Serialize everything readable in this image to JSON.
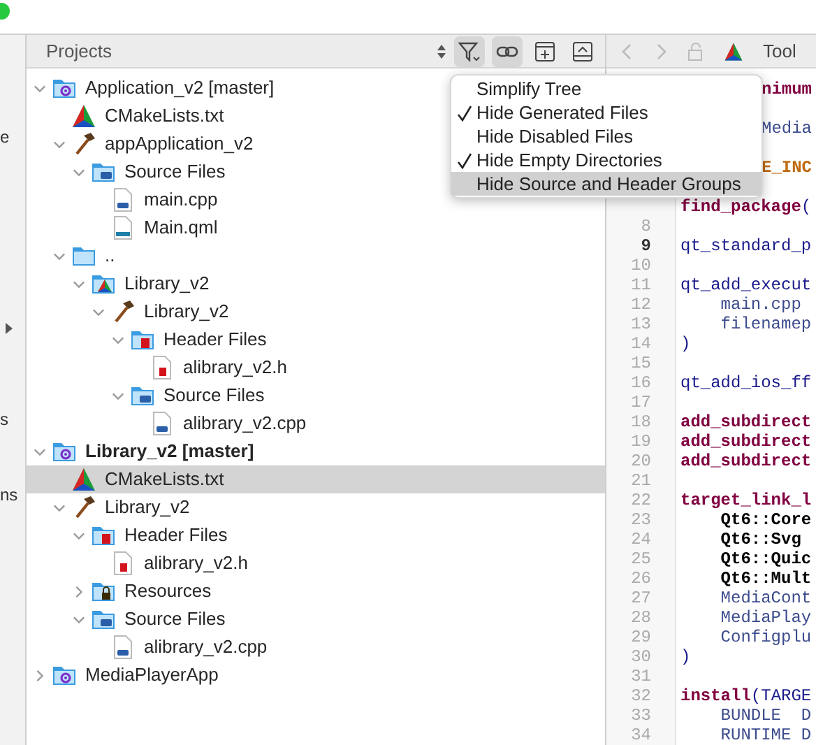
{
  "sidebar_strip": {
    "labels": [
      {
        "text": "e",
        "kind": "text"
      },
      {
        "kind": "arrow"
      },
      {
        "text": "s",
        "kind": "text"
      },
      {
        "text": "ns",
        "kind": "text"
      }
    ]
  },
  "projects_panel": {
    "title": "Projects",
    "toolbar": [
      {
        "kind": "filter",
        "pressed": true
      },
      {
        "kind": "link",
        "pressed": true
      },
      {
        "kind": "split",
        "pressed": false
      },
      {
        "kind": "collapse",
        "pressed": false
      }
    ],
    "filter_menu": [
      {
        "label": "Simplify Tree",
        "checked": false,
        "selected": false
      },
      {
        "label": "Hide Generated Files",
        "checked": true,
        "selected": false
      },
      {
        "label": "Hide Disabled Files",
        "checked": false,
        "selected": false
      },
      {
        "label": "Hide Empty Directories",
        "checked": true,
        "selected": false
      },
      {
        "label": "Hide Source and Header Groups",
        "checked": false,
        "selected": true
      }
    ],
    "tree": [
      {
        "label": "Application_v2 [master]",
        "kind": "project",
        "active": false,
        "selected": false,
        "expanded": true,
        "children": [
          {
            "label": "CMakeLists.txt",
            "kind": "cmake",
            "selected": false
          },
          {
            "label": "appApplication_v2",
            "kind": "target",
            "selected": false,
            "expanded": true,
            "children": [
              {
                "label": "Source Files",
                "kind": "source-folder",
                "selected": false,
                "expanded": true,
                "children": [
                  {
                    "label": "main.cpp",
                    "kind": "cpp",
                    "selected": false
                  },
                  {
                    "label": "Main.qml",
                    "kind": "qml",
                    "selected": false
                  }
                ]
              }
            ]
          },
          {
            "label": "..",
            "kind": "folder",
            "selected": false,
            "expanded": true,
            "children": [
              {
                "label": "Library_v2",
                "kind": "cmake-folder",
                "selected": false,
                "expanded": true,
                "children": [
                  {
                    "label": "Library_v2",
                    "kind": "target",
                    "selected": false,
                    "expanded": true,
                    "children": [
                      {
                        "label": "Header Files",
                        "kind": "header-folder",
                        "selected": false,
                        "expanded": true,
                        "children": [
                          {
                            "label": "alibrary_v2.h",
                            "kind": "header",
                            "selected": false
                          }
                        ]
                      },
                      {
                        "label": "Source Files",
                        "kind": "source-folder",
                        "selected": false,
                        "expanded": true,
                        "children": [
                          {
                            "label": "alibrary_v2.cpp",
                            "kind": "cpp",
                            "selected": false
                          }
                        ]
                      }
                    ]
                  }
                ]
              }
            ]
          }
        ]
      },
      {
        "label": "Library_v2 [master]",
        "kind": "project",
        "active": true,
        "selected": false,
        "expanded": true,
        "children": [
          {
            "label": "CMakeLists.txt",
            "kind": "cmake",
            "selected": true
          },
          {
            "label": "Library_v2",
            "kind": "target",
            "selected": false,
            "expanded": true,
            "children": [
              {
                "label": "Header Files",
                "kind": "header-folder",
                "selected": false,
                "expanded": true,
                "children": [
                  {
                    "label": "alibrary_v2.h",
                    "kind": "header",
                    "selected": false
                  }
                ]
              },
              {
                "label": "Resources",
                "kind": "resource-folder",
                "selected": false,
                "expanded": false
              },
              {
                "label": "Source Files",
                "kind": "source-folder",
                "selected": false,
                "expanded": true,
                "children": [
                  {
                    "label": "alibrary_v2.cpp",
                    "kind": "cpp",
                    "selected": false
                  }
                ]
              }
            ]
          }
        ]
      },
      {
        "label": "MediaPlayerApp",
        "kind": "project",
        "active": false,
        "selected": false,
        "expanded": false
      }
    ]
  },
  "editor": {
    "toolbar_title": "Tool",
    "lines": [
      {
        "covered_fragment": {
          "text": "nimum",
          "kind": "keyword"
        }
      },
      {
        "covered_fragment": {
          "text": "Media",
          "kind": "arg"
        }
      },
      {
        "covered_fragment": {
          "text": "E_INC",
          "kind": "variable"
        }
      },
      {
        "tokens": [
          {
            "text": "find_package",
            "kind": "keyword"
          },
          {
            "text": "(",
            "kind": "function"
          }
        ]
      },
      {
        "number": "8"
      },
      {
        "number": "9",
        "current": true,
        "tokens": [
          {
            "text": "qt_standard_p",
            "kind": "function"
          }
        ]
      },
      {
        "number": "10"
      },
      {
        "number": "11",
        "tokens": [
          {
            "text": "qt_add_execut",
            "kind": "function"
          }
        ]
      },
      {
        "number": "12",
        "tokens": [
          {
            "text": "    main.cpp",
            "kind": "arg"
          }
        ]
      },
      {
        "number": "13",
        "tokens": [
          {
            "text": "    filenamep",
            "kind": "arg"
          }
        ]
      },
      {
        "number": "14",
        "tokens": [
          {
            "text": ")",
            "kind": "function"
          }
        ]
      },
      {
        "number": "15"
      },
      {
        "number": "16",
        "tokens": [
          {
            "text": "qt_add_ios_ff",
            "kind": "function"
          }
        ]
      },
      {
        "number": "17"
      },
      {
        "number": "18",
        "tokens": [
          {
            "text": "add_subdirect",
            "kind": "keyword"
          }
        ]
      },
      {
        "number": "19",
        "tokens": [
          {
            "text": "add_subdirect",
            "kind": "keyword"
          }
        ]
      },
      {
        "number": "20",
        "tokens": [
          {
            "text": "add_subdirect",
            "kind": "keyword"
          }
        ]
      },
      {
        "number": "21"
      },
      {
        "number": "22",
        "tokens": [
          {
            "text": "target_link_l",
            "kind": "keyword"
          }
        ]
      },
      {
        "number": "23",
        "tokens": [
          {
            "text": "    Qt6::Core",
            "kind": "target"
          }
        ]
      },
      {
        "number": "24",
        "tokens": [
          {
            "text": "    Qt6::Svg",
            "kind": "target"
          }
        ]
      },
      {
        "number": "25",
        "tokens": [
          {
            "text": "    Qt6::Quic",
            "kind": "target"
          }
        ]
      },
      {
        "number": "26",
        "tokens": [
          {
            "text": "    Qt6::Mult",
            "kind": "target"
          }
        ]
      },
      {
        "number": "27",
        "tokens": [
          {
            "text": "    MediaCont",
            "kind": "arg"
          }
        ]
      },
      {
        "number": "28",
        "tokens": [
          {
            "text": "    MediaPlay",
            "kind": "arg"
          }
        ]
      },
      {
        "number": "29",
        "tokens": [
          {
            "text": "    Configplu",
            "kind": "arg"
          }
        ]
      },
      {
        "number": "30",
        "tokens": [
          {
            "text": ")",
            "kind": "function"
          }
        ]
      },
      {
        "number": "31"
      },
      {
        "number": "32",
        "tokens": [
          {
            "text": "install",
            "kind": "keyword"
          },
          {
            "text": "(TARGE",
            "kind": "function"
          }
        ]
      },
      {
        "number": "33",
        "tokens": [
          {
            "text": "    BUNDLE  D",
            "kind": "arg"
          }
        ]
      },
      {
        "number": "34",
        "tokens": [
          {
            "text": "    RUNTIME D",
            "kind": "arg"
          }
        ]
      }
    ]
  }
}
